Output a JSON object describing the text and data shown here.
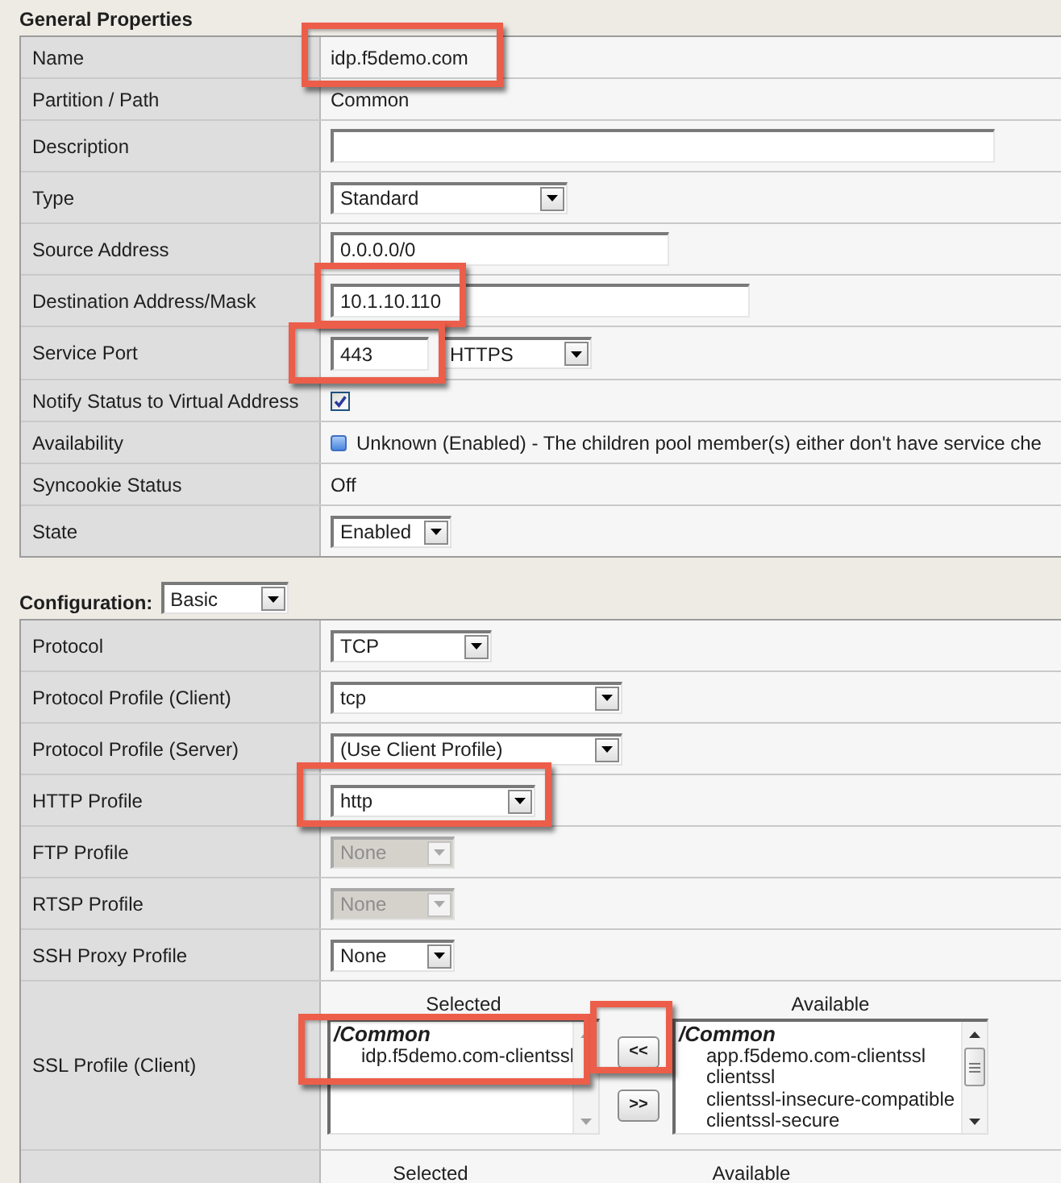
{
  "general_properties": {
    "title": "General Properties",
    "rows": [
      {
        "label": "Name",
        "kind": "text",
        "value": "idp.f5demo.com",
        "highlighted": true
      },
      {
        "label": "Partition / Path",
        "kind": "text",
        "value": "Common",
        "highlighted": false
      },
      {
        "label": "Description",
        "kind": "input",
        "highlighted": false
      },
      {
        "label": "Type",
        "kind": "select",
        "value": "Standard",
        "disabled": false,
        "highlighted": false
      },
      {
        "label": "Source Address",
        "kind": "input",
        "value": "0.0.0.0/0",
        "highlighted": false
      },
      {
        "label": "Destination Address/Mask",
        "kind": "input",
        "value": "10.1.10.110",
        "highlighted": true
      },
      {
        "label": "Service Port",
        "kind": "port",
        "value": "443",
        "service": "HTTPS",
        "highlighted": true
      },
      {
        "label": "Notify Status to Virtual Address",
        "kind": "checkbox",
        "checked": true,
        "highlighted": false
      },
      {
        "label": "Availability",
        "kind": "status",
        "value": "Unknown (Enabled) - The children pool member(s) either don't have service che",
        "highlighted": false
      },
      {
        "label": "Syncookie Status",
        "kind": "text",
        "value": "Off",
        "highlighted": false
      },
      {
        "label": "State",
        "kind": "select",
        "value": "Enabled",
        "disabled": false,
        "highlighted": false
      }
    ]
  },
  "configuration": {
    "label": "Configuration:",
    "mode": "Basic",
    "rows": [
      {
        "label": "Protocol",
        "kind": "select",
        "value": "TCP",
        "disabled": false,
        "highlighted": false
      },
      {
        "label": "Protocol Profile (Client)",
        "kind": "select",
        "value": "tcp",
        "disabled": false,
        "highlighted": false
      },
      {
        "label": "Protocol Profile (Server)",
        "kind": "select",
        "value": "(Use Client Profile)",
        "disabled": false,
        "highlighted": false
      },
      {
        "label": "HTTP Profile",
        "kind": "select",
        "value": "http",
        "disabled": false,
        "highlighted": true
      },
      {
        "label": "FTP Profile",
        "kind": "select",
        "value": "None",
        "disabled": true,
        "highlighted": false
      },
      {
        "label": "RTSP Profile",
        "kind": "select",
        "value": "None",
        "disabled": true,
        "highlighted": false
      },
      {
        "label": "SSH Proxy Profile",
        "kind": "select",
        "value": "None",
        "disabled": false,
        "highlighted": false
      },
      {
        "label": "SSL Profile (Client)",
        "kind": "dual_list",
        "selected_heading": "Selected",
        "available_heading": "Available",
        "selected_list": {
          "group": "/Common",
          "items": [
            "idp.f5demo.com-clientssl"
          ],
          "highlighted": true
        },
        "buttons": [
          {
            "label": "<<",
            "highlighted": true
          },
          {
            "label": ">>",
            "highlighted": false
          }
        ],
        "available_list": {
          "group": "/Common",
          "items": [
            "app.f5demo.com-clientssl",
            "clientssl",
            "clientssl-insecure-compatible",
            "clientssl-secure"
          ],
          "highlighted": false
        }
      },
      {
        "kind": "list_headings",
        "selected_heading": "Selected",
        "available_heading": "Available"
      }
    ]
  }
}
